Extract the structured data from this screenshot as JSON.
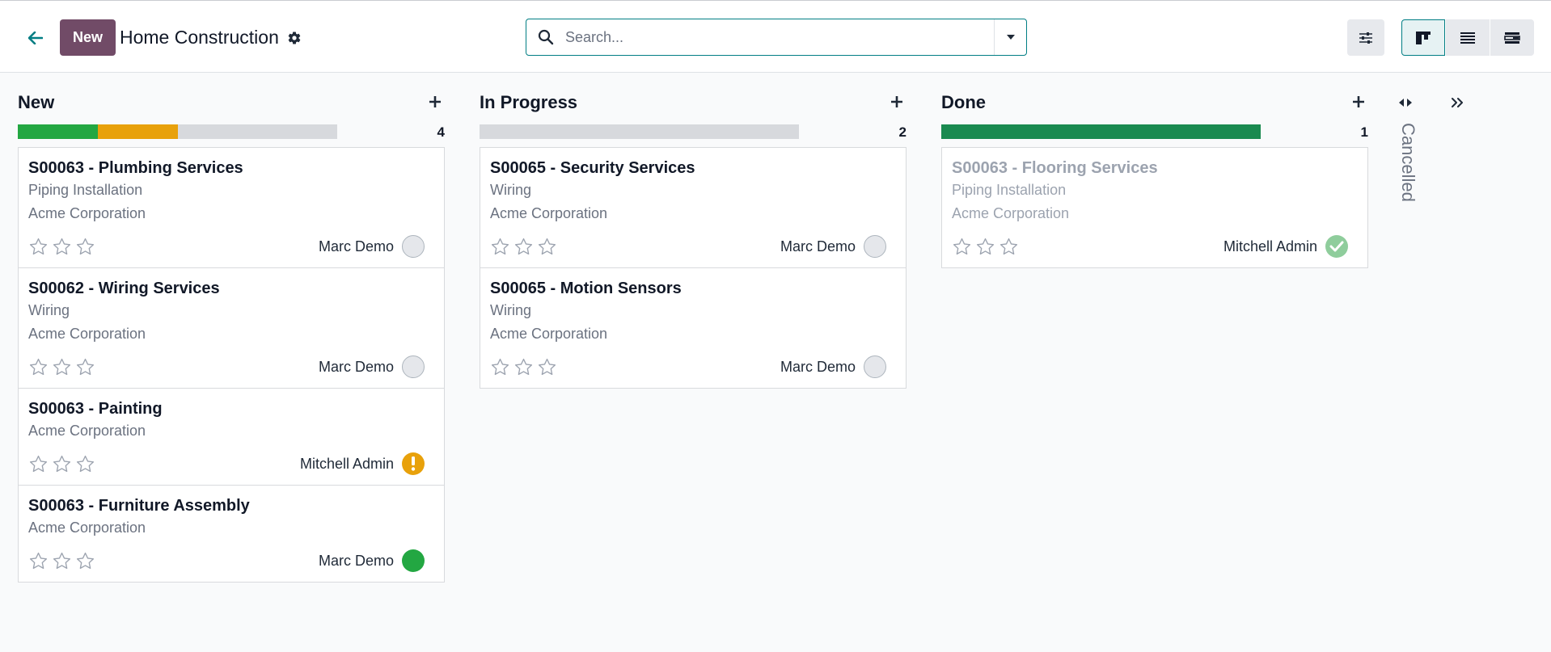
{
  "header": {
    "new_label": "New",
    "title": "Home Construction",
    "search_placeholder": "Search..."
  },
  "colors": {
    "brand": "#714b67",
    "accent": "#017e84",
    "progress_done": "#23a742",
    "progress_blocked": "#e8a10b",
    "progress_empty": "#d7d9dd",
    "progress_all_done": "#1a8a50"
  },
  "columns": [
    {
      "title": "New",
      "count": "4",
      "progress": [
        {
          "state": "done",
          "fraction": 0.25,
          "color": "#23a742"
        },
        {
          "state": "blocked",
          "fraction": 0.25,
          "color": "#e8a10b"
        },
        {
          "state": "normal",
          "fraction": 0.5,
          "color": "#d7d9dd"
        }
      ],
      "cards": [
        {
          "title": "S00063 - Plumbing Services",
          "lines": [
            "Piping Installation",
            "Acme Corporation"
          ],
          "assignee": "Marc Demo",
          "state": "normal",
          "stars": 0
        },
        {
          "title": "S00062 - Wiring Services",
          "lines": [
            "Wiring",
            "Acme Corporation"
          ],
          "assignee": "Marc Demo",
          "state": "normal",
          "stars": 0
        },
        {
          "title": "S00063 - Painting",
          "lines": [
            "Acme Corporation"
          ],
          "assignee": "Mitchell Admin",
          "state": "blocked",
          "stars": 0
        },
        {
          "title": "S00063 - Furniture Assembly",
          "lines": [
            "Acme Corporation"
          ],
          "assignee": "Marc Demo",
          "state": "done",
          "stars": 0
        }
      ]
    },
    {
      "title": "In Progress",
      "count": "2",
      "progress": [
        {
          "state": "normal",
          "fraction": 1.0,
          "color": "#d7d9dd"
        }
      ],
      "cards": [
        {
          "title": "S00065 - Security Services",
          "lines": [
            "Wiring",
            "Acme Corporation"
          ],
          "assignee": "Marc Demo",
          "state": "normal",
          "stars": 0
        },
        {
          "title": "S00065 - Motion Sensors",
          "lines": [
            "Wiring",
            "Acme Corporation"
          ],
          "assignee": "Marc Demo",
          "state": "normal",
          "stars": 0
        }
      ]
    },
    {
      "title": "Done",
      "count": "1",
      "progress": [
        {
          "state": "done",
          "fraction": 1.0,
          "color": "#1a8a50"
        }
      ],
      "cards": [
        {
          "title": "S00063 - Flooring Services",
          "lines": [
            "Piping Installation",
            "Acme Corporation"
          ],
          "assignee": "Mitchell Admin",
          "state": "approved",
          "stars": 0,
          "muted": true
        }
      ]
    }
  ],
  "folded_column": {
    "title": "Cancelled"
  }
}
